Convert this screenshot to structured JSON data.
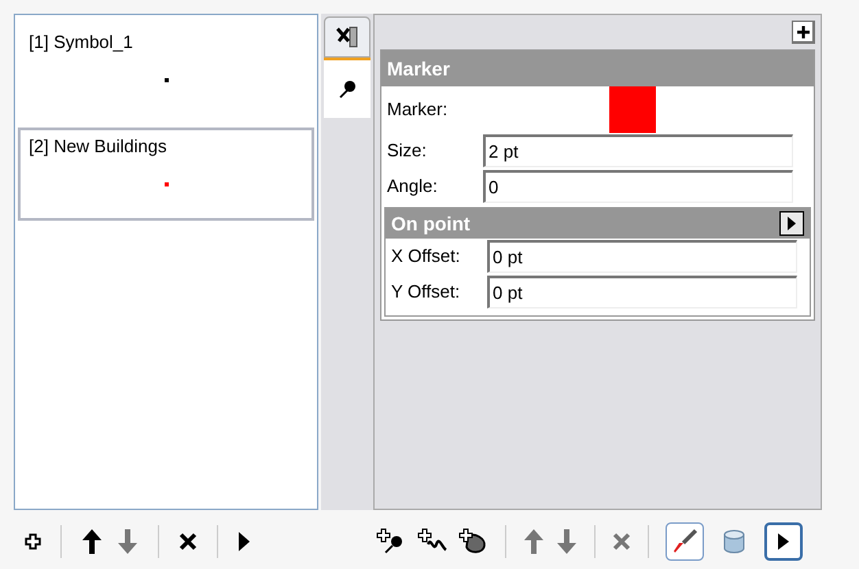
{
  "symbols": [
    {
      "label": "[1] Symbol_1",
      "color": "#000000",
      "selected": false
    },
    {
      "label": "[2] New Buildings",
      "color": "#ff0000",
      "selected": true
    }
  ],
  "side_tabs": [
    {
      "kind": "scale",
      "selected": false
    },
    {
      "kind": "marker",
      "selected": true
    }
  ],
  "marker_section": {
    "title": "Marker",
    "fields": [
      {
        "kind": "color",
        "label": "Marker:",
        "color": "#ff0000"
      },
      {
        "kind": "text",
        "label": "Size:",
        "value": "2 pt"
      },
      {
        "kind": "text",
        "label": "Angle:",
        "value": "0"
      }
    ]
  },
  "on_point_section": {
    "title": "On point",
    "fields": [
      {
        "label": "X Offset:",
        "value": "0 pt"
      },
      {
        "label": "Y Offset:",
        "value": "0 pt"
      }
    ]
  },
  "left_toolbar": [
    {
      "kind": "add",
      "disabled": false
    },
    {
      "kind": "sep"
    },
    {
      "kind": "up",
      "disabled": false
    },
    {
      "kind": "down",
      "disabled": true
    },
    {
      "kind": "sep"
    },
    {
      "kind": "delete",
      "disabled": false
    },
    {
      "kind": "sep"
    },
    {
      "kind": "play",
      "disabled": false
    }
  ],
  "right_toolbar": [
    {
      "kind": "add-point",
      "disabled": false
    },
    {
      "kind": "add-line",
      "disabled": false
    },
    {
      "kind": "add-area",
      "disabled": false
    },
    {
      "kind": "sep"
    },
    {
      "kind": "up",
      "disabled": true
    },
    {
      "kind": "down",
      "disabled": true
    },
    {
      "kind": "sep"
    },
    {
      "kind": "delete",
      "disabled": true
    },
    {
      "kind": "sep"
    },
    {
      "kind": "brush",
      "selected": true
    },
    {
      "kind": "cylinder",
      "selected": false
    },
    {
      "kind": "play-box",
      "disabled": false
    }
  ]
}
